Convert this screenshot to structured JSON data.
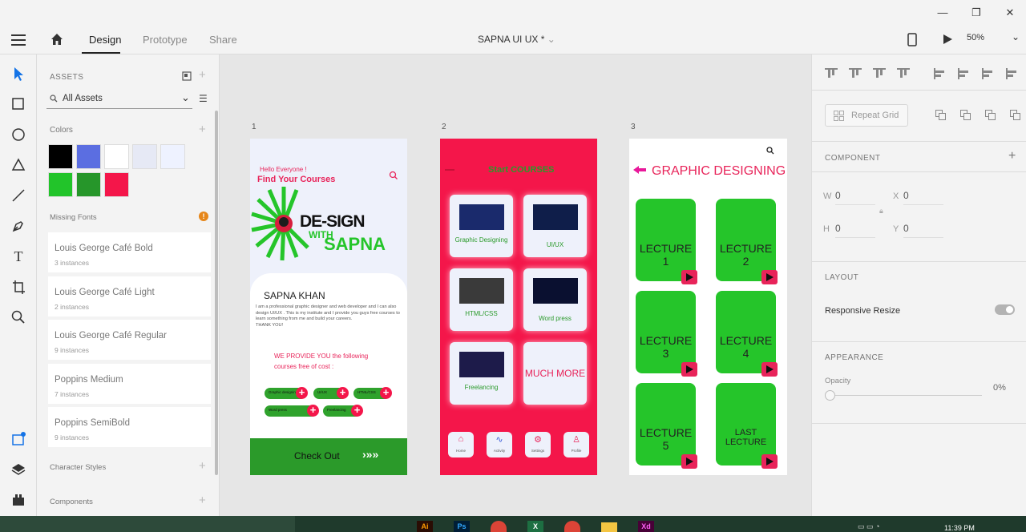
{
  "window": {
    "minimize": "—",
    "restore": "❐",
    "close": "✕"
  },
  "menubar": {
    "tabs": [
      "Design",
      "Prototype",
      "Share"
    ],
    "doc_title": "SAPNA UI UX *",
    "zoom": "50%"
  },
  "assets": {
    "heading": "ASSETS",
    "filter": "All Assets",
    "colors_label": "Colors",
    "colors": [
      "#000000",
      "#5b6ee1",
      "#ffffff",
      "#e6e9f5",
      "#eef2ff",
      "#22c42a",
      "#26962a",
      "#f4164a"
    ],
    "missing_fonts_label": "Missing Fonts",
    "fonts": [
      {
        "name": "Louis George Café Bold",
        "instances": "3 instances"
      },
      {
        "name": "Louis George Café Light",
        "instances": "2 instances"
      },
      {
        "name": "Louis George Café Regular",
        "instances": "9 instances"
      },
      {
        "name": "Poppins Medium",
        "instances": "7 instances"
      },
      {
        "name": "Poppins SemiBold",
        "instances": "9 instances"
      }
    ],
    "character_styles": "Character Styles",
    "components": "Components"
  },
  "artboards": {
    "labels": [
      "1",
      "2",
      "3"
    ],
    "a1": {
      "hello": "Hello Everyone !",
      "find": "Find Your Courses",
      "logo_line1": "DE-SIGN",
      "logo_line2": "WITH",
      "logo_line3": "SAPNA",
      "name": "SAPNA KHAN",
      "bio": "I am a professional graphic designer and web developer and I can also design UI/UX . This is my institute and I provide you guys free courses to learn something from me and build your careers.",
      "thanks": "THANK YOU!",
      "provide": "WE PROVIDE YOU the following courses free of cost :",
      "chips": [
        "Graphic designing",
        "UI/UX",
        "HTML/CSS",
        "Word press",
        "Freelancing"
      ],
      "checkout": "Check Out",
      "arrows": "›»»"
    },
    "a2": {
      "title": "Start COURSES",
      "cards": [
        "Graphic Designing",
        "UI/UX",
        "HTML/CSS",
        "Word press",
        "Freelancing",
        "MUCH MORE"
      ],
      "nav": [
        "Home",
        "Activity",
        "Settings",
        "Profile"
      ]
    },
    "a3": {
      "title": "GRAPHIC DESIGNING",
      "lectures": [
        "LECTURE 1",
        "LECTURE 2",
        "LECTURE 3",
        "LECTURE 4",
        "LECTURE 5",
        "LAST LECTURE"
      ]
    }
  },
  "rightpanel": {
    "repeat_grid": "Repeat Grid",
    "component": "COMPONENT",
    "w_label": "W",
    "w_value": "0",
    "x_label": "X",
    "x_value": "0",
    "h_label": "H",
    "h_value": "0",
    "y_label": "Y",
    "y_value": "0",
    "layout": "LAYOUT",
    "responsive": "Responsive Resize",
    "appearance": "APPEARANCE",
    "opacity_label": "Opacity",
    "opacity_value": "0%"
  },
  "taskbar": {
    "time": "11:39 PM"
  }
}
